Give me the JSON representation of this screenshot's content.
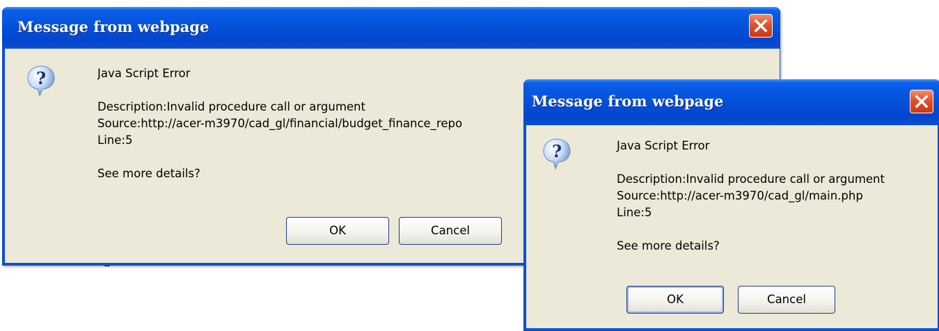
{
  "dialogs": [
    {
      "title": "Message from webpage",
      "heading": "Java Script Error",
      "description": "Description:Invalid procedure call or argument",
      "source": "Source:http://acer-m3970/cad_gl/financial/budget_finance_repo",
      "line": "Line:5",
      "prompt": "See more details?",
      "ok_label": "OK",
      "cancel_label": "Cancel"
    },
    {
      "title": "Message from webpage",
      "heading": "Java Script Error",
      "description": "Description:Invalid procedure call or argument",
      "source": "Source:http://acer-m3970/cad_gl/main.php",
      "line": "Line:5",
      "prompt": "See more details?",
      "ok_label": "OK",
      "cancel_label": "Cancel"
    }
  ],
  "icons": {
    "question": "question-icon",
    "close": "close-icon"
  },
  "colors": {
    "titlebar": "#0452db",
    "client": "#ece9d8",
    "close": "#e0522c"
  }
}
